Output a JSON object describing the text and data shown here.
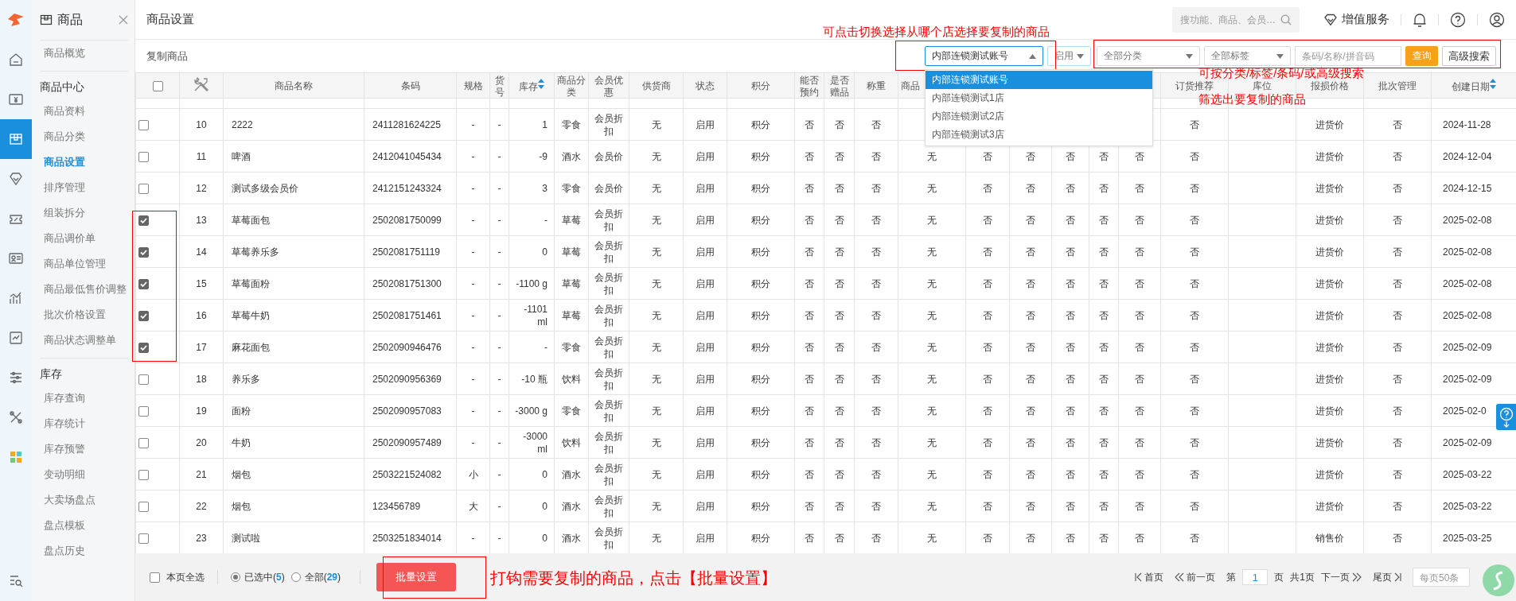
{
  "rail": {
    "items": [
      {
        "selected": false
      },
      {
        "selected": false
      },
      {
        "selected": true
      },
      {
        "selected": false
      },
      {
        "selected": false
      },
      {
        "selected": false
      },
      {
        "selected": false
      },
      {
        "selected": false
      },
      {
        "selected": false
      },
      {
        "selected": false
      },
      {
        "selected": false
      },
      {
        "selected": false
      }
    ]
  },
  "sidebar": {
    "title": "商品",
    "overview": {
      "label": "商品概览",
      "selected": false
    },
    "sections": [
      {
        "heading": "商品中心",
        "items": [
          {
            "label": "商品资料",
            "selected": false
          },
          {
            "label": "商品分类",
            "selected": false
          },
          {
            "label": "商品设置",
            "selected": true
          },
          {
            "label": "排序管理",
            "selected": false
          },
          {
            "label": "组装拆分",
            "selected": false
          },
          {
            "label": "商品调价单",
            "selected": false
          },
          {
            "label": "商品单位管理",
            "selected": false
          },
          {
            "label": "商品最低售价调整",
            "selected": false
          },
          {
            "label": "批次价格设置",
            "selected": false
          },
          {
            "label": "商品状态调整单",
            "selected": false
          }
        ]
      },
      {
        "heading": "库存",
        "items": [
          {
            "label": "库存查询",
            "selected": false
          },
          {
            "label": "库存统计",
            "selected": false
          },
          {
            "label": "库存预警",
            "selected": false
          },
          {
            "label": "变动明细",
            "selected": false
          },
          {
            "label": "大卖场盘点",
            "selected": false
          },
          {
            "label": "盘点模板",
            "selected": false
          },
          {
            "label": "盘点历史",
            "selected": false
          }
        ]
      }
    ]
  },
  "header": {
    "title": "商品设置",
    "search": {
      "placeholder": "搜功能、商品、会员…"
    },
    "vip": "增值服务"
  },
  "toolbar": {
    "title": "复制商品",
    "store_select": {
      "value": "内部连锁测试账号",
      "expanded": true,
      "options": [
        {
          "label": "内部连锁测试账号",
          "selected": true
        },
        {
          "label": "内部连锁测试1店",
          "selected": false
        },
        {
          "label": "内部连锁测试2店",
          "selected": false
        },
        {
          "label": "内部连锁测试3店",
          "selected": false
        }
      ]
    },
    "status_select": {
      "value": "启用",
      "expanded": false
    },
    "category_select": {
      "value": "全部分类",
      "expanded": false
    },
    "tag_select": {
      "value": "全部标签",
      "expanded": false
    },
    "keyword": {
      "placeholder": "条码/名称/拼音码"
    },
    "query_button": "查询",
    "advanced_button": "高级搜索"
  },
  "table": {
    "header_checked": false,
    "header": {
      "name": "商品名称",
      "barcode": "条码",
      "spec": "规格",
      "item_no": "货号",
      "stock": "库存",
      "category": "商品分类",
      "member_price": "会员优惠",
      "supplier": "供货商",
      "status": "状态",
      "points": "积分",
      "reservable": "能否预约",
      "gift": "是否赠品",
      "weighed": "称重",
      "column_16": "商品",
      "order_recommend": "订货推荐",
      "location": "库位",
      "loss_price": "报损价格",
      "batch": "批次管理",
      "created": "创建日期"
    },
    "rows": [
      {
        "checked": false,
        "no": "10",
        "name": "2222",
        "barcode": "2411281624225",
        "spec": "-",
        "item_no": "-",
        "stock": "1",
        "category": "零食",
        "member_price": "会员折扣",
        "supplier": "无",
        "status": "启用",
        "points": "积分",
        "reservable": "否",
        "gift": "否",
        "weighed": "否",
        "order_recommend": "否",
        "loss_price": "进货价",
        "batch": "否",
        "created": "2024-11-28"
      },
      {
        "checked": false,
        "no": "11",
        "name": "啤酒",
        "barcode": "2412041045434",
        "spec": "-",
        "item_no": "-",
        "stock": "-9",
        "category": "酒水",
        "member_price": "会员价",
        "supplier": "无",
        "status": "启用",
        "points": "积分",
        "reservable": "否",
        "gift": "否",
        "weighed": "否",
        "column_16": "无",
        "column_17": "否",
        "column_18": "否",
        "column_19": "否",
        "column_20": "否",
        "column_21": "否",
        "order_recommend": "否",
        "loss_price": "进货价",
        "batch": "否",
        "created": "2024-12-04"
      },
      {
        "checked": false,
        "no": "12",
        "name": "测试多级会员价",
        "barcode": "2412151243324",
        "spec": "-",
        "item_no": "-",
        "stock": "3",
        "category": "零食",
        "member_price": "会员价",
        "supplier": "无",
        "status": "启用",
        "points": "积分",
        "reservable": "否",
        "gift": "否",
        "weighed": "否",
        "column_16": "无",
        "column_17": "否",
        "column_18": "否",
        "column_19": "否",
        "column_20": "否",
        "column_21": "否",
        "order_recommend": "否",
        "loss_price": "进货价",
        "batch": "否",
        "created": "2024-12-15"
      },
      {
        "checked": true,
        "no": "13",
        "name": "草莓面包",
        "barcode": "2502081750099",
        "spec": "-",
        "item_no": "-",
        "stock": "-",
        "category": "草莓",
        "member_price": "会员折扣",
        "supplier": "无",
        "status": "启用",
        "points": "积分",
        "reservable": "否",
        "gift": "否",
        "weighed": "否",
        "column_16": "无",
        "column_17": "否",
        "column_18": "否",
        "column_19": "否",
        "column_20": "否",
        "column_21": "否",
        "order_recommend": "否",
        "loss_price": "进货价",
        "batch": "否",
        "created": "2025-02-08"
      },
      {
        "checked": true,
        "no": "14",
        "name": "草莓养乐多",
        "barcode": "2502081751119",
        "spec": "-",
        "item_no": "-",
        "stock": "0",
        "category": "草莓",
        "member_price": "会员折扣",
        "supplier": "无",
        "status": "启用",
        "points": "积分",
        "reservable": "否",
        "gift": "否",
        "weighed": "否",
        "column_16": "无",
        "column_17": "否",
        "column_18": "否",
        "column_19": "否",
        "column_20": "否",
        "column_21": "否",
        "order_recommend": "否",
        "loss_price": "进货价",
        "batch": "否",
        "created": "2025-02-08"
      },
      {
        "checked": true,
        "no": "15",
        "name": "草莓面粉",
        "barcode": "2502081751300",
        "spec": "-",
        "item_no": "-",
        "stock": "-1100 g",
        "category": "草莓",
        "member_price": "会员折扣",
        "supplier": "无",
        "status": "启用",
        "points": "积分",
        "reservable": "否",
        "gift": "否",
        "weighed": "否",
        "column_16": "无",
        "column_17": "否",
        "column_18": "否",
        "column_19": "否",
        "column_20": "否",
        "column_21": "否",
        "order_recommend": "否",
        "loss_price": "进货价",
        "batch": "否",
        "created": "2025-02-08"
      },
      {
        "checked": true,
        "no": "16",
        "name": "草莓牛奶",
        "barcode": "2502081751461",
        "spec": "-",
        "item_no": "-",
        "stock": "-1101 ml",
        "category": "草莓",
        "member_price": "会员折扣",
        "supplier": "无",
        "status": "启用",
        "points": "积分",
        "reservable": "否",
        "gift": "否",
        "weighed": "否",
        "column_16": "无",
        "column_17": "否",
        "column_18": "否",
        "column_19": "否",
        "column_20": "否",
        "column_21": "否",
        "order_recommend": "否",
        "loss_price": "进货价",
        "batch": "否",
        "created": "2025-02-08"
      },
      {
        "checked": true,
        "no": "17",
        "name": "麻花面包",
        "barcode": "2502090946476",
        "spec": "-",
        "item_no": "-",
        "stock": "-",
        "category": "零食",
        "member_price": "会员折扣",
        "supplier": "无",
        "status": "启用",
        "points": "积分",
        "reservable": "否",
        "gift": "否",
        "weighed": "否",
        "column_16": "无",
        "column_17": "否",
        "column_18": "否",
        "column_19": "否",
        "column_20": "否",
        "column_21": "否",
        "order_recommend": "否",
        "loss_price": "进货价",
        "batch": "否",
        "created": "2025-02-09"
      },
      {
        "checked": false,
        "no": "18",
        "name": "养乐多",
        "barcode": "2502090956369",
        "spec": "-",
        "item_no": "-",
        "stock": "-10 瓶",
        "category": "饮料",
        "member_price": "会员折扣",
        "supplier": "无",
        "status": "启用",
        "points": "积分",
        "reservable": "否",
        "gift": "否",
        "weighed": "否",
        "column_16": "无",
        "column_17": "否",
        "column_18": "否",
        "column_19": "否",
        "column_20": "否",
        "column_21": "否",
        "order_recommend": "否",
        "loss_price": "进货价",
        "batch": "否",
        "created": "2025-02-09"
      },
      {
        "checked": false,
        "no": "19",
        "name": "面粉",
        "barcode": "2502090957083",
        "spec": "-",
        "item_no": "-",
        "stock": "-3000 g",
        "category": "零食",
        "member_price": "会员折扣",
        "supplier": "无",
        "status": "启用",
        "points": "积分",
        "reservable": "否",
        "gift": "否",
        "weighed": "否",
        "column_16": "无",
        "column_17": "否",
        "column_18": "否",
        "column_19": "否",
        "column_20": "否",
        "column_21": "否",
        "order_recommend": "否",
        "loss_price": "进货价",
        "batch": "否",
        "created": "2025-02-0"
      },
      {
        "checked": false,
        "no": "20",
        "name": "牛奶",
        "barcode": "2502090957489",
        "spec": "-",
        "item_no": "-",
        "stock": "-3000 ml",
        "category": "饮料",
        "member_price": "会员折扣",
        "supplier": "无",
        "status": "启用",
        "points": "积分",
        "reservable": "否",
        "gift": "否",
        "weighed": "否",
        "column_16": "无",
        "column_17": "否",
        "column_18": "否",
        "column_19": "否",
        "column_20": "否",
        "column_21": "否",
        "order_recommend": "否",
        "loss_price": "进货价",
        "batch": "否",
        "created": "2025-02-09"
      },
      {
        "checked": false,
        "no": "21",
        "name": "烟包",
        "barcode": "2503221524082",
        "spec": "小",
        "item_no": "-",
        "stock": "0",
        "category": "酒水",
        "member_price": "会员折扣",
        "supplier": "无",
        "status": "启用",
        "points": "积分",
        "reservable": "否",
        "gift": "否",
        "weighed": "否",
        "column_16": "无",
        "column_17": "否",
        "column_18": "否",
        "column_19": "否",
        "column_20": "否",
        "column_21": "否",
        "order_recommend": "否",
        "loss_price": "进货价",
        "batch": "否",
        "created": "2025-03-22"
      },
      {
        "checked": false,
        "no": "22",
        "name": "烟包",
        "barcode": "123456789",
        "spec": "大",
        "item_no": "-",
        "stock": "0",
        "category": "酒水",
        "member_price": "会员折扣",
        "supplier": "无",
        "status": "启用",
        "points": "积分",
        "reservable": "否",
        "gift": "否",
        "weighed": "否",
        "column_16": "无",
        "column_17": "否",
        "column_18": "否",
        "column_19": "否",
        "column_20": "否",
        "column_21": "否",
        "order_recommend": "否",
        "loss_price": "进货价",
        "batch": "否",
        "created": "2025-03-22"
      },
      {
        "checked": false,
        "no": "23",
        "name": "测试啦",
        "barcode": "2503251834014",
        "spec": "-",
        "item_no": "-",
        "stock": "0",
        "category": "酒水",
        "member_price": "会员折扣",
        "supplier": "无",
        "status": "启用",
        "points": "积分",
        "reservable": "否",
        "gift": "否",
        "weighed": "否",
        "column_16": "无",
        "column_17": "否",
        "column_18": "否",
        "column_19": "否",
        "column_20": "否",
        "column_21": "否",
        "order_recommend": "否",
        "loss_price": "销售价",
        "batch": "否",
        "created": "2025-03-25"
      }
    ]
  },
  "footer": {
    "select_page": {
      "label": "本页全选",
      "checked": false
    },
    "scope": [
      {
        "label": "已选中(**5**)",
        "selected": true
      },
      {
        "label": "全部(**29**)",
        "selected": false
      }
    ],
    "batch_button": "批量设置",
    "pager": {
      "first": "首页",
      "prev": "前一页",
      "page_prefix": "第",
      "page": "1",
      "page_suffix": "页",
      "total": "共1页",
      "next": "下一页",
      "last": "尾页",
      "page_size": "每页50条"
    }
  },
  "annotations": [
    "可点击切换选择从哪个店选择要复制的商品",
    "可按分类/标签/条码/或高级搜索",
    "筛选出要复制的商品",
    "打钩需要复制的商品，点击【批量设置】"
  ]
}
